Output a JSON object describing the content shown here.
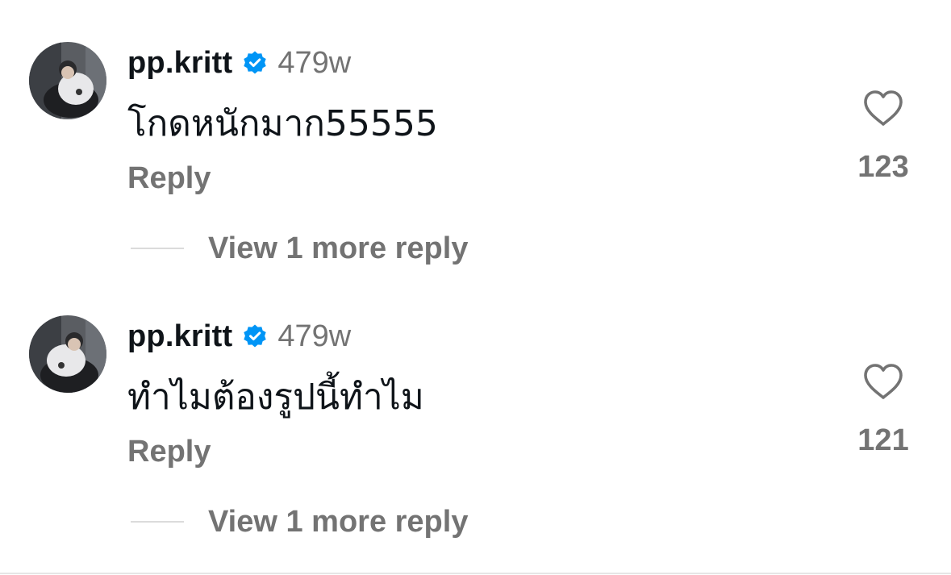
{
  "comments": [
    {
      "username": "pp.kritt",
      "verified_icon": "verified-badge-icon",
      "time": "479w",
      "text": "โกดหนักมาก55555",
      "reply_label": "Reply",
      "like_icon": "heart-outline-icon",
      "likes": "123",
      "view_replies_label": "View 1 more reply"
    },
    {
      "username": "pp.kritt",
      "verified_icon": "verified-badge-icon",
      "time": "479w",
      "text": "ทำไมต้องรูปนี้ทำไม",
      "reply_label": "Reply",
      "like_icon": "heart-outline-icon",
      "likes": "121",
      "view_replies_label": "View 1 more reply"
    }
  ],
  "colors": {
    "primary_text": "#0f1419",
    "secondary_text": "#737373",
    "verified_blue": "#0095f6",
    "divider": "#dbdbdb"
  }
}
